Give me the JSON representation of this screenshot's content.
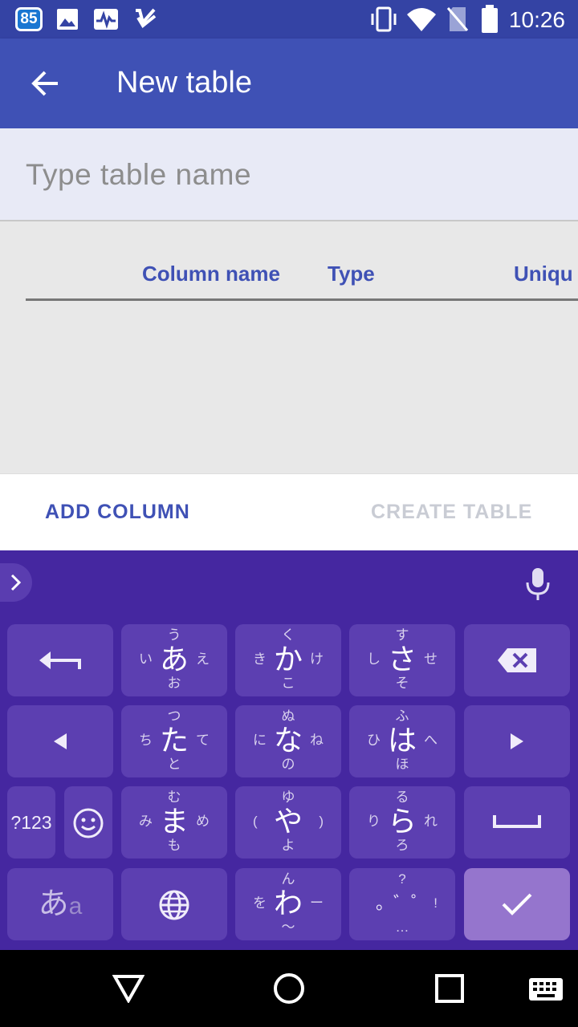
{
  "status_bar": {
    "notification_badge": "85",
    "time": "10:26",
    "left_icons": [
      "image-icon",
      "pulse-icon",
      "check-icon"
    ],
    "right_icons": [
      "vibrate-icon",
      "wifi-icon",
      "no-sim-icon",
      "battery-icon"
    ]
  },
  "app_bar": {
    "title": "New table",
    "color": "#3f51b5"
  },
  "table_name": {
    "placeholder": "Type table name",
    "value": ""
  },
  "table_header": {
    "columns": [
      "Column name",
      "Type",
      "Uniqu"
    ]
  },
  "actions": {
    "add_column": "ADD COLUMN",
    "create_table": "CREATE TABLE"
  },
  "keyboard": {
    "row1": [
      {
        "main": "あ",
        "up": "う",
        "left": "い",
        "right": "え",
        "down": "お"
      },
      {
        "main": "か",
        "up": "く",
        "left": "き",
        "right": "け",
        "down": "こ"
      },
      {
        "main": "さ",
        "up": "す",
        "left": "し",
        "right": "せ",
        "down": "そ"
      }
    ],
    "row2": [
      {
        "main": "た",
        "up": "つ",
        "left": "ち",
        "right": "て",
        "down": "と"
      },
      {
        "main": "な",
        "up": "ぬ",
        "left": "に",
        "right": "ね",
        "down": "の"
      },
      {
        "main": "は",
        "up": "ふ",
        "left": "ひ",
        "right": "へ",
        "down": "ほ"
      }
    ],
    "row3": [
      {
        "main": "ま",
        "up": "む",
        "left": "み",
        "right": "め",
        "down": "も"
      },
      {
        "main": "や",
        "up": "ゆ",
        "left": "(",
        "right": ")",
        "down": "よ"
      },
      {
        "main": "ら",
        "up": "る",
        "left": "り",
        "right": "れ",
        "down": "ろ"
      }
    ],
    "row4": [
      {
        "main": "わ",
        "up": "ん",
        "left": "を",
        "right": "ー",
        "down": "〜"
      },
      {
        "main": "。゛゜",
        "up": "?",
        "left": "",
        "right": "!",
        "down": "…"
      }
    ],
    "numeric_label": "?123",
    "kana_label_main": "あ",
    "kana_label_sub": "a"
  }
}
